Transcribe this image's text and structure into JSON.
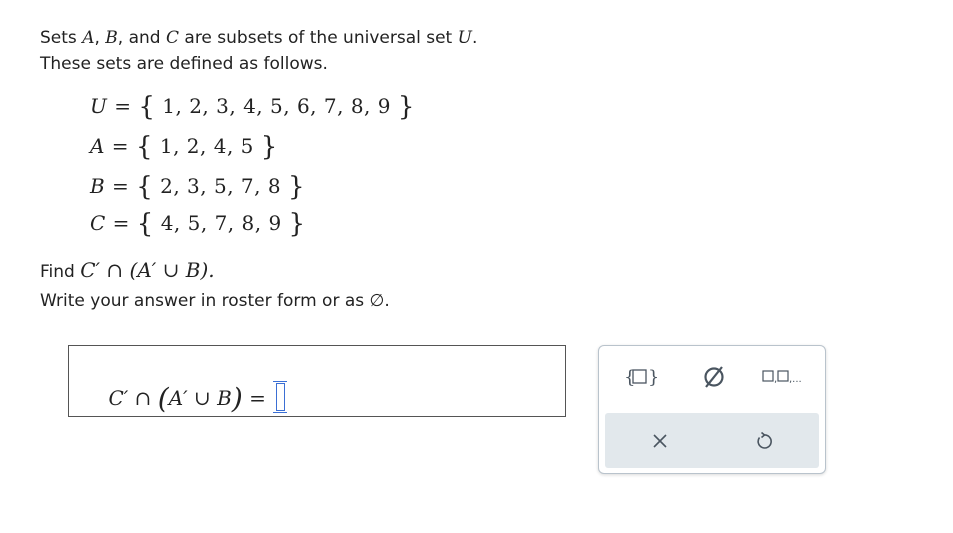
{
  "intro": {
    "line1_a": "Sets ",
    "set_a": "A",
    "comma1": ", ",
    "set_b": "B",
    "and": ", and ",
    "set_c": "C",
    "line1_b": " are subsets of the universal set ",
    "set_u": "U",
    "period": ".",
    "line2": "These sets are defined as follows."
  },
  "sets": [
    {
      "name": "U",
      "elements": "1, 2, 3, 4, 5, 6, 7, 8, 9"
    },
    {
      "name": "A",
      "elements": "1, 2, 4, 5"
    },
    {
      "name": "B",
      "elements": "2, 3, 5, 7, 8"
    },
    {
      "name": "C",
      "elements": "4, 5, 7, 8, 9"
    }
  ],
  "question": {
    "find_label": "Find ",
    "expression": "C′ ∩ (A′ ∪ B).",
    "write_text": "Write your answer in roster form or as ",
    "empty_symbol": "∅",
    "write_end": "."
  },
  "answer": {
    "lhs": "C′ ∩ ",
    "inner": "A′ ∪ B",
    "equals": " = ",
    "value": ""
  },
  "palette": {
    "braces_icon": "set-braces-icon",
    "empty_icon": "empty-set-icon",
    "list_icon": "list-elements-icon",
    "clear_icon": "close-icon",
    "undo_icon": "undo-icon"
  }
}
